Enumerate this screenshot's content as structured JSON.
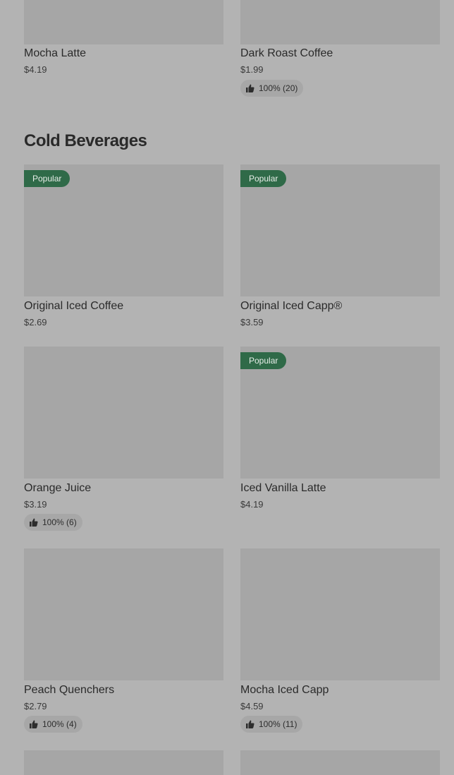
{
  "section": {
    "title": "Cold Beverages"
  },
  "top_items": [
    {
      "name": "Mocha Latte",
      "price": "$4.19"
    },
    {
      "name": "Dark Roast Coffee",
      "price": "$1.99",
      "rating": "100% (20)"
    }
  ],
  "badge_label": "Popular",
  "cold_items": [
    {
      "name": "Original Iced Coffee",
      "price": "$2.69",
      "badge": "Popular"
    },
    {
      "name": "Original Iced Capp®",
      "price": "$3.59",
      "badge": "Popular"
    },
    {
      "name": "Orange Juice",
      "price": "$3.19",
      "rating": "100% (6)"
    },
    {
      "name": "Iced Vanilla Latte",
      "price": "$4.19",
      "badge": "Popular"
    },
    {
      "name": "Peach Quenchers",
      "price": "$2.79",
      "rating": "100% (4)"
    },
    {
      "name": "Mocha Iced Capp",
      "price": "$4.59",
      "rating": "100% (11)"
    }
  ],
  "icons": {
    "rating": "thumbs-up-icon"
  }
}
